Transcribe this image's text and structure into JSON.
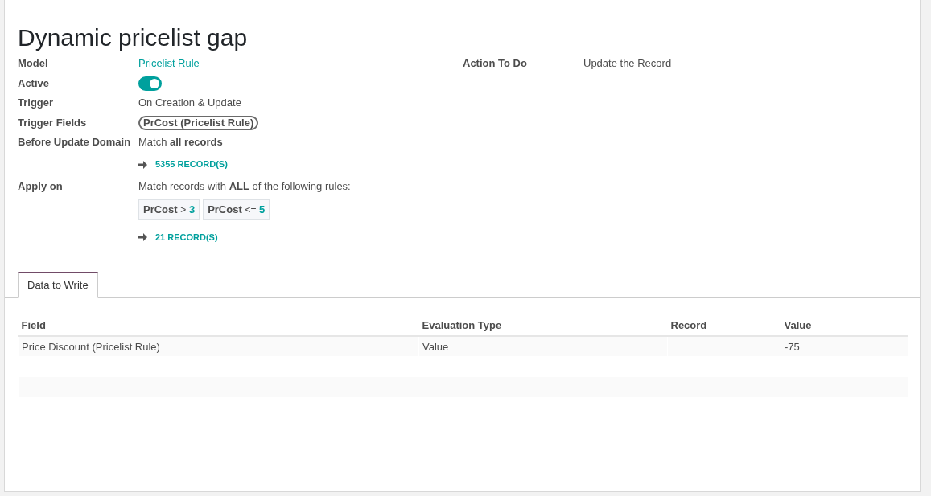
{
  "title": "Dynamic pricelist gap",
  "fields": [
    {
      "kind": "link",
      "label": "Model",
      "value": "Pricelist Rule"
    },
    {
      "kind": "toggle",
      "label": "Active",
      "on": true
    },
    {
      "kind": "text",
      "label": "Trigger",
      "value": "On Creation & Update"
    },
    {
      "kind": "tag",
      "label": "Trigger Fields",
      "tags": [
        "PrCost (Pricelist Rule)"
      ]
    },
    {
      "kind": "domain",
      "label": "Before Update Domain",
      "value": "Match **all records**",
      "count": "5355 RECORD(S)"
    },
    {
      "kind": "domain",
      "label": "Apply on",
      "value": "Match records with **ALL** of the following rules:",
      "rules": [
        {
          "field": "PrCost",
          "operator": ">",
          "value": "3"
        },
        {
          "field": "PrCost",
          "operator": "<=",
          "value": "5"
        }
      ],
      "count": "21 RECORD(S)"
    }
  ],
  "right_fields": [
    {
      "kind": "text",
      "label": "Action To Do",
      "value": "Update the Record"
    }
  ],
  "tabs": [
    {
      "label": "Data to Write",
      "selected": true
    }
  ],
  "table": {
    "columns": [
      "Field",
      "Evaluation Type",
      "Record",
      "Value"
    ],
    "rows": [
      [
        "Price Discount (Pricelist Rule)",
        "Value",
        "",
        "-75"
      ]
    ]
  }
}
